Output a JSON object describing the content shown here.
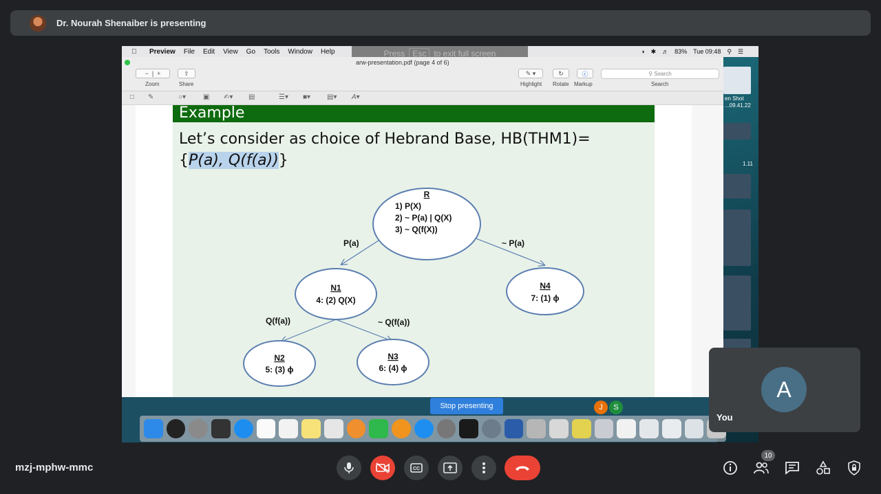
{
  "banner": {
    "presenter_text": "Dr. Nourah Shenaiber is presenting"
  },
  "mac": {
    "menu": [
      "Preview",
      "File",
      "Edit",
      "View",
      "Go",
      "Tools",
      "Window",
      "Help"
    ],
    "status": {
      "battery": "83%",
      "clock": "Tue 09:48"
    },
    "esc_hint": {
      "press": "Press",
      "key": "Esc",
      "rest": "to exit full screen"
    }
  },
  "preview": {
    "doc_title": "arw-presentation.pdf (page 4 of 6)",
    "toolbar": {
      "zoom": "Zoom",
      "share": "Share",
      "highlight": "Highlight",
      "rotate": "Rotate",
      "markup": "Markup",
      "search_label": "Search",
      "search_placeholder": "Search"
    },
    "screenshot_label": "en Shot\n...09.41.22",
    "side_value": "1.11"
  },
  "slide": {
    "heading": "Example",
    "line1": "Let’s consider as choice of Hebrand Base, HB(THM1)=",
    "line2_open": "{",
    "line2_hl": "P(a), Q(f(a))",
    "line2_close": "}",
    "tree": {
      "root": {
        "title": "R",
        "lines": [
          "1)  P(X)",
          "2) ~ P(a) | Q(X)",
          "3) ~ Q(f(X))"
        ]
      },
      "n1": {
        "title": "N1",
        "line": "4: (2) Q(X)"
      },
      "n4": {
        "title": "N4",
        "line": "7: (1) ϕ"
      },
      "n2": {
        "title": "N2",
        "line": "5: (3) ϕ"
      },
      "n3": {
        "title": "N3",
        "line": "6: (4) ϕ"
      },
      "edges": {
        "r_n1": "P(a)",
        "r_n4": "~ P(a)",
        "n1_n2": "Q(f(a))",
        "n1_n3": "~ Q(f(a))"
      }
    }
  },
  "share_controls": {
    "stop_presenting": "Stop presenting",
    "pill_j": "J",
    "pill_s": "S"
  },
  "self_tile": {
    "initial": "A",
    "label": "You"
  },
  "meeting": {
    "code": "mzj-mphw-mmc",
    "participants_count": "10"
  },
  "colors": {
    "end_call": "#ea4335",
    "slide_header": "#0f6b0f",
    "highlight": "#b9d3ec"
  }
}
